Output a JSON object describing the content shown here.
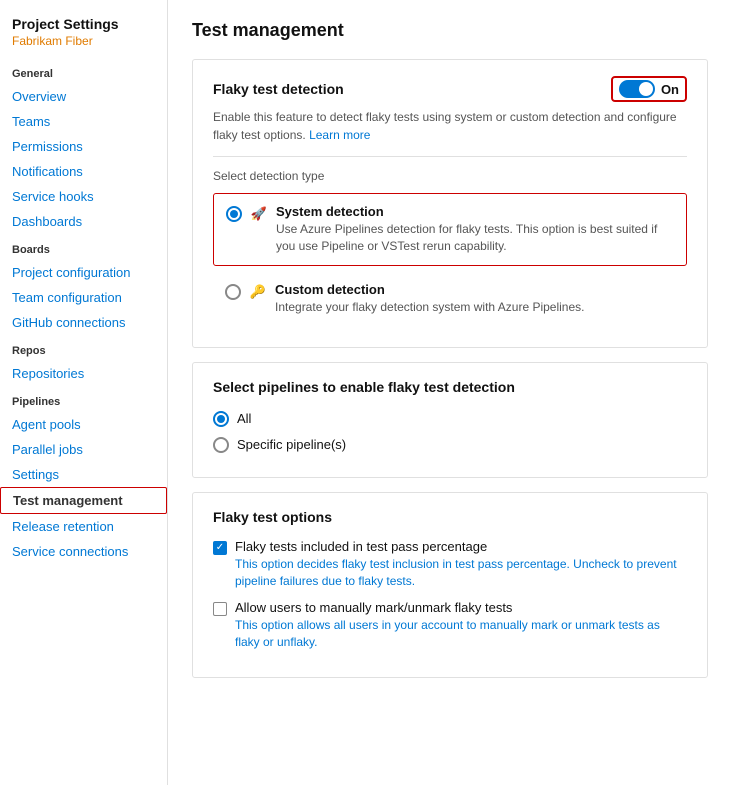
{
  "sidebar": {
    "title": "Project Settings",
    "subtitle": "Fabrikam Fiber",
    "sections": [
      {
        "header": "General",
        "items": [
          {
            "label": "Overview",
            "active": false
          },
          {
            "label": "Teams",
            "active": false
          },
          {
            "label": "Permissions",
            "active": false
          },
          {
            "label": "Notifications",
            "active": false
          },
          {
            "label": "Service hooks",
            "active": false
          },
          {
            "label": "Dashboards",
            "active": false
          }
        ]
      },
      {
        "header": "Boards",
        "items": [
          {
            "label": "Project configuration",
            "active": false
          },
          {
            "label": "Team configuration",
            "active": false
          },
          {
            "label": "GitHub connections",
            "active": false
          }
        ]
      },
      {
        "header": "Repos",
        "items": [
          {
            "label": "Repositories",
            "active": false
          }
        ]
      },
      {
        "header": "Pipelines",
        "items": [
          {
            "label": "Agent pools",
            "active": false
          },
          {
            "label": "Parallel jobs",
            "active": false
          },
          {
            "label": "Settings",
            "active": false
          },
          {
            "label": "Test management",
            "active": true
          },
          {
            "label": "Release retention",
            "active": false
          },
          {
            "label": "Service connections",
            "active": false
          }
        ]
      }
    ]
  },
  "main": {
    "page_title": "Test management",
    "flaky_detection": {
      "title": "Flaky test detection",
      "toggle_label": "On",
      "toggle_on": true,
      "description": "Enable this feature to detect flaky tests using system or custom detection and configure flaky test options.",
      "learn_more": "Learn more",
      "detection_type_label": "Select detection type",
      "options": [
        {
          "id": "system",
          "title": "System detection",
          "description": "Use Azure Pipelines detection for flaky tests. This option is best suited if you use Pipeline or VSTest rerun capability.",
          "selected": true,
          "icon": "rocket"
        },
        {
          "id": "custom",
          "title": "Custom detection",
          "description": "Integrate your flaky detection system with Azure Pipelines.",
          "selected": false,
          "icon": "key"
        }
      ]
    },
    "pipeline_selection": {
      "title": "Select pipelines to enable flaky test detection",
      "options": [
        {
          "label": "All",
          "selected": true
        },
        {
          "label": "Specific pipeline(s)",
          "selected": false
        }
      ]
    },
    "flaky_options": {
      "title": "Flaky test options",
      "checkboxes": [
        {
          "id": "include_pass",
          "checked": true,
          "title": "Flaky tests included in test pass percentage",
          "description": "This option decides flaky test inclusion in test pass percentage. Uncheck to prevent pipeline failures due to flaky tests."
        },
        {
          "id": "manual_mark",
          "checked": false,
          "title": "Allow users to manually mark/unmark flaky tests",
          "description": "This option allows all users in your account to manually mark or unmark tests as flaky or unflaky."
        }
      ]
    }
  }
}
